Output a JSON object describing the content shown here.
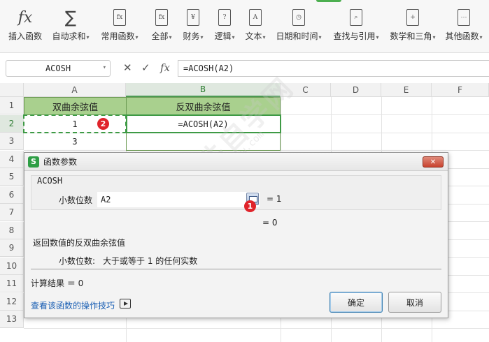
{
  "ribbon": {
    "items": [
      {
        "label": "插入函数",
        "icon": "fx-icon",
        "glyph": "fx",
        "caret": false
      },
      {
        "label": "自动求和",
        "icon": "sigma-icon",
        "glyph": "∑",
        "caret": true
      },
      {
        "label": "常用函数",
        "icon": "common-function-icon",
        "glyph": "fx",
        "caret": true
      },
      {
        "label": "全部",
        "icon": "all-functions-icon",
        "glyph": "fx",
        "caret": true
      },
      {
        "label": "财务",
        "icon": "finance-icon",
        "glyph": "¥",
        "caret": true
      },
      {
        "label": "逻辑",
        "icon": "logic-icon",
        "glyph": "?",
        "caret": true
      },
      {
        "label": "文本",
        "icon": "text-icon",
        "glyph": "A",
        "caret": true
      },
      {
        "label": "日期和时间",
        "icon": "clock-icon",
        "glyph": "◷",
        "caret": true
      },
      {
        "label": "查找与引用",
        "icon": "lookup-icon",
        "glyph": "⌕",
        "caret": true
      },
      {
        "label": "数学和三角",
        "icon": "math-icon",
        "glyph": "+",
        "caret": true
      },
      {
        "label": "其他函数",
        "icon": "other-functions-icon",
        "glyph": "⋯",
        "caret": true
      }
    ]
  },
  "formula_bar": {
    "name_box": "ACOSH",
    "cancel_glyph": "✕",
    "confirm_glyph": "✓",
    "fx_glyph": "fx",
    "formula": "=ACOSH(A2)"
  },
  "sheet": {
    "columns": [
      "A",
      "B",
      "C",
      "D",
      "E",
      "F"
    ],
    "rows": [
      "1",
      "2",
      "3",
      "4",
      "5",
      "6",
      "7",
      "8",
      "9",
      "10",
      "11",
      "12",
      "13"
    ],
    "cells": {
      "a1": "双曲余弦值",
      "b1": "反双曲余弦值",
      "a2": "1",
      "b2": "=ACOSH(A2)",
      "a3": "3"
    },
    "accent_color": "#a9d08e"
  },
  "badges": {
    "one": "1",
    "two": "2"
  },
  "watermark": {
    "main": "软件自学网",
    "url": "www.rjzxw.com"
  },
  "dialog": {
    "title": "函数参数",
    "app_icon": "S",
    "close_glyph": "✕",
    "function_name": "ACOSH",
    "arg_label": "小数位数",
    "arg_value": "A2",
    "arg_result": "=  1",
    "function_result": "=  0",
    "description": "返回数值的反双曲余弦值",
    "arg_desc_label": "小数位数:",
    "arg_desc": "大于或等于 1 的任何实数",
    "calc_result": "计算结果 ＝ 0",
    "help_link": "查看该函数的操作技巧",
    "ok_label": "确定",
    "cancel_label": "取消"
  }
}
